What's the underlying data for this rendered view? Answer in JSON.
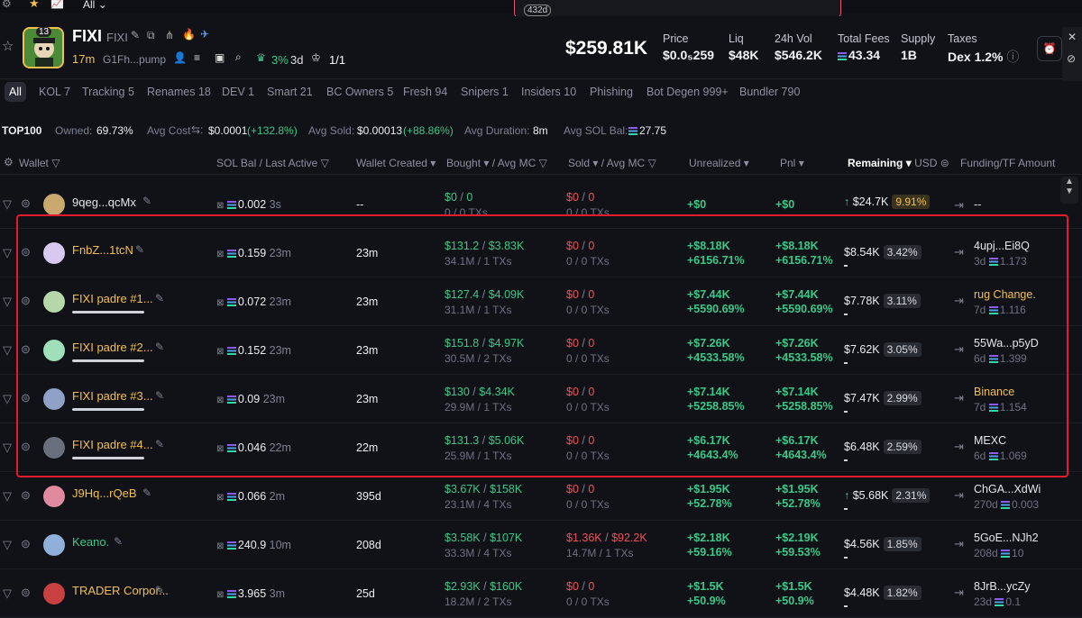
{
  "topbar": {
    "all_label": "All",
    "popup_age": "432d"
  },
  "token": {
    "name": "FIXI",
    "ticker": "FIXI",
    "age": "17m",
    "address": "G1Fh...pump",
    "holders_badge": "13",
    "growth": "3%",
    "growth_time": "3d",
    "pro_count": "1/1",
    "market_cap": "$259.81K",
    "stats": [
      {
        "label": "Price",
        "value": "$0.0₅259"
      },
      {
        "label": "Liq",
        "value": "$48K"
      },
      {
        "label": "24h Vol",
        "value": "$546.2K"
      },
      {
        "label": "Total Fees",
        "value": "43.34"
      },
      {
        "label": "Supply",
        "value": "1B"
      },
      {
        "label": "Taxes",
        "value": "Dex 1.2%"
      }
    ]
  },
  "tabs": [
    "All",
    "KOL 7",
    "Tracking 5",
    "Renames 18",
    "DEV 1",
    "Smart 21",
    "BC Owners 5",
    "Fresh 94",
    "Snipers 1",
    "Insiders 10",
    "Phishing",
    "Bot Degen 999+",
    "Bundler 790"
  ],
  "top100": {
    "label": "TOP100",
    "owned_label": "Owned:",
    "owned": "69.73%",
    "avg_cost_label": "Avg Cost",
    "avg_cost": "$0.0001",
    "avg_cost_pct": "(+132.8%)",
    "avg_sold_label": "Avg Sold:",
    "avg_sold": "$0.00013",
    "avg_sold_pct": "(+88.86%)",
    "avg_duration_label": "Avg Duration:",
    "avg_duration": "8m",
    "avg_sol_label": "Avg SOL Bal:",
    "avg_sol": "27.75"
  },
  "columns": {
    "wallet": "Wallet",
    "sol_bal": "SOL Bal",
    "last_active": "/ Last Active",
    "wallet_created": "Wallet Created",
    "bought": "Bought",
    "avg_mc": "/ Avg MC",
    "sold": "Sold",
    "avg_mc2": "/ Avg MC",
    "unrealized": "Unrealized",
    "pnl": "Pnl",
    "remaining": "Remaining",
    "usd": "USD",
    "funding": "Funding/TF Amount"
  },
  "rows": [
    {
      "wallet": "9qeg...qcMx",
      "sol": "0.002",
      "last": "3s",
      "created": "--",
      "bought": "$0",
      "bought_mc": "0",
      "bought_sub": "0 / 0 TXs",
      "sold": "$0",
      "sold_mc": "0",
      "sold_sub": "0 / 0 TXs",
      "unreal": "+$0",
      "unreal_pct": "",
      "pnl": "+$0",
      "pnl_pct": "",
      "remain": "$24.7K",
      "remain_pct": "9.91%",
      "fund": "--",
      "fund_age": "",
      "fund_amt": ""
    },
    {
      "wallet": "FnbZ...1tcN",
      "sol": "0.159",
      "last": "23m",
      "created": "23m",
      "bought": "$131.2",
      "bought_mc": "$3.83K",
      "bought_sub": "34.1M / 1 TXs",
      "sold": "$0",
      "sold_mc": "0",
      "sold_sub": "0 / 0 TXs",
      "unreal": "+$8.18K",
      "unreal_pct": "+6156.71%",
      "pnl": "+$8.18K",
      "pnl_pct": "+6156.71%",
      "remain": "$8.54K",
      "remain_pct": "3.42%",
      "fund": "4upj...Ei8Q",
      "fund_age": "3d",
      "fund_amt": "1.173"
    },
    {
      "wallet": "FIXI padre #1...",
      "sol": "0.072",
      "last": "23m",
      "created": "23m",
      "bought": "$127.4",
      "bought_mc": "$4.09K",
      "bought_sub": "31.1M / 1 TXs",
      "sold": "$0",
      "sold_mc": "0",
      "sold_sub": "0 / 0 TXs",
      "unreal": "+$7.44K",
      "unreal_pct": "+5590.69%",
      "pnl": "+$7.44K",
      "pnl_pct": "+5590.69%",
      "remain": "$7.78K",
      "remain_pct": "3.11%",
      "fund": "rug Change.",
      "fund_age": "7d",
      "fund_amt": "1.116"
    },
    {
      "wallet": "FIXI padre #2...",
      "sol": "0.152",
      "last": "23m",
      "created": "23m",
      "bought": "$151.8",
      "bought_mc": "$4.97K",
      "bought_sub": "30.5M / 2 TXs",
      "sold": "$0",
      "sold_mc": "0",
      "sold_sub": "0 / 0 TXs",
      "unreal": "+$7.26K",
      "unreal_pct": "+4533.58%",
      "pnl": "+$7.26K",
      "pnl_pct": "+4533.58%",
      "remain": "$7.62K",
      "remain_pct": "3.05%",
      "fund": "55Wa...p5yD",
      "fund_age": "6d",
      "fund_amt": "1.399"
    },
    {
      "wallet": "FIXI padre #3...",
      "sol": "0.09",
      "last": "23m",
      "created": "23m",
      "bought": "$130",
      "bought_mc": "$4.34K",
      "bought_sub": "29.9M / 1 TXs",
      "sold": "$0",
      "sold_mc": "0",
      "sold_sub": "0 / 0 TXs",
      "unreal": "+$7.14K",
      "unreal_pct": "+5258.85%",
      "pnl": "+$7.14K",
      "pnl_pct": "+5258.85%",
      "remain": "$7.47K",
      "remain_pct": "2.99%",
      "fund": "Binance",
      "fund_age": "7d",
      "fund_amt": "1.154"
    },
    {
      "wallet": "FIXI padre #4...",
      "sol": "0.046",
      "last": "22m",
      "created": "22m",
      "bought": "$131.3",
      "bought_mc": "$5.06K",
      "bought_sub": "25.9M / 1 TXs",
      "sold": "$0",
      "sold_mc": "0",
      "sold_sub": "0 / 0 TXs",
      "unreal": "+$6.17K",
      "unreal_pct": "+4643.4%",
      "pnl": "+$6.17K",
      "pnl_pct": "+4643.4%",
      "remain": "$6.48K",
      "remain_pct": "2.59%",
      "fund": "MEXC",
      "fund_age": "6d",
      "fund_amt": "1.069"
    },
    {
      "wallet": "J9Hq...rQeB",
      "sol": "0.066",
      "last": "2m",
      "created": "395d",
      "bought": "$3.67K",
      "bought_mc": "$158K",
      "bought_sub": "23.1M / 4 TXs",
      "sold": "$0",
      "sold_mc": "0",
      "sold_sub": "0 / 0 TXs",
      "unreal": "+$1.95K",
      "unreal_pct": "+52.78%",
      "pnl": "+$1.95K",
      "pnl_pct": "+52.78%",
      "remain": "$5.68K",
      "remain_pct": "2.31%",
      "fund": "ChGA...XdWi",
      "fund_age": "270d",
      "fund_amt": "0.003"
    },
    {
      "wallet": "Keano.",
      "sol": "240.9",
      "last": "10m",
      "created": "208d",
      "bought": "$3.58K",
      "bought_mc": "$107K",
      "bought_sub": "33.3M / 4 TXs",
      "sold": "$1.36K",
      "sold_mc": "$92.2K",
      "sold_sub": "14.7M / 1 TXs",
      "unreal": "+$2.18K",
      "unreal_pct": "+59.16%",
      "pnl": "+$2.19K",
      "pnl_pct": "+59.53%",
      "remain": "$4.56K",
      "remain_pct": "1.85%",
      "fund": "5GoE...NJh2",
      "fund_age": "208d",
      "fund_amt": "10"
    },
    {
      "wallet": "TRADER Corpor...",
      "sol": "3.965",
      "last": "3m",
      "created": "25d",
      "bought": "$2.93K",
      "bought_mc": "$160K",
      "bought_sub": "18.2M / 2 TXs",
      "sold": "$0",
      "sold_mc": "0",
      "sold_sub": "0 / 0 TXs",
      "unreal": "+$1.5K",
      "unreal_pct": "+50.9%",
      "pnl": "+$1.5K",
      "pnl_pct": "+50.9%",
      "remain": "$4.48K",
      "remain_pct": "1.82%",
      "fund": "8JrB...ycZy",
      "fund_age": "23d",
      "fund_amt": "0.1"
    }
  ]
}
